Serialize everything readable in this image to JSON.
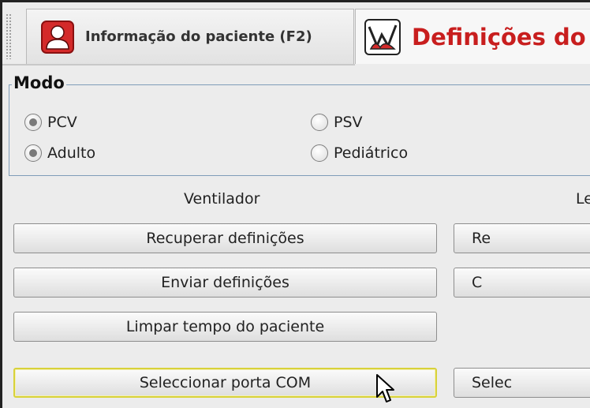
{
  "tabs": [
    {
      "label": "Informação do paciente (F2)",
      "icon": "patient-icon",
      "active": false
    },
    {
      "label": "Definições do",
      "icon": "lungs-icon",
      "active": true,
      "color": "#c81e1e"
    }
  ],
  "modo": {
    "title": "Modo",
    "options": [
      {
        "label": "PCV",
        "selected": true
      },
      {
        "label": "PSV",
        "selected": false
      },
      {
        "label": "Adulto",
        "selected": true
      },
      {
        "label": "Pediátrico",
        "selected": false
      }
    ]
  },
  "ventilador": {
    "heading": "Ventilador",
    "buttons": [
      {
        "label": "Recuperar definições"
      },
      {
        "label": "Enviar definições"
      },
      {
        "label": "Limpar tempo do paciente"
      },
      {
        "label": "Seleccionar porta COM",
        "focused": true
      }
    ]
  },
  "right_column": {
    "heading": "Le",
    "buttons": [
      {
        "label": "Re"
      },
      {
        "label": "C"
      },
      {
        "label": "Selec"
      }
    ]
  },
  "colors": {
    "accent": "#c81e1e",
    "focus_border": "#d8d23a",
    "group_border": "#7f9db9"
  }
}
